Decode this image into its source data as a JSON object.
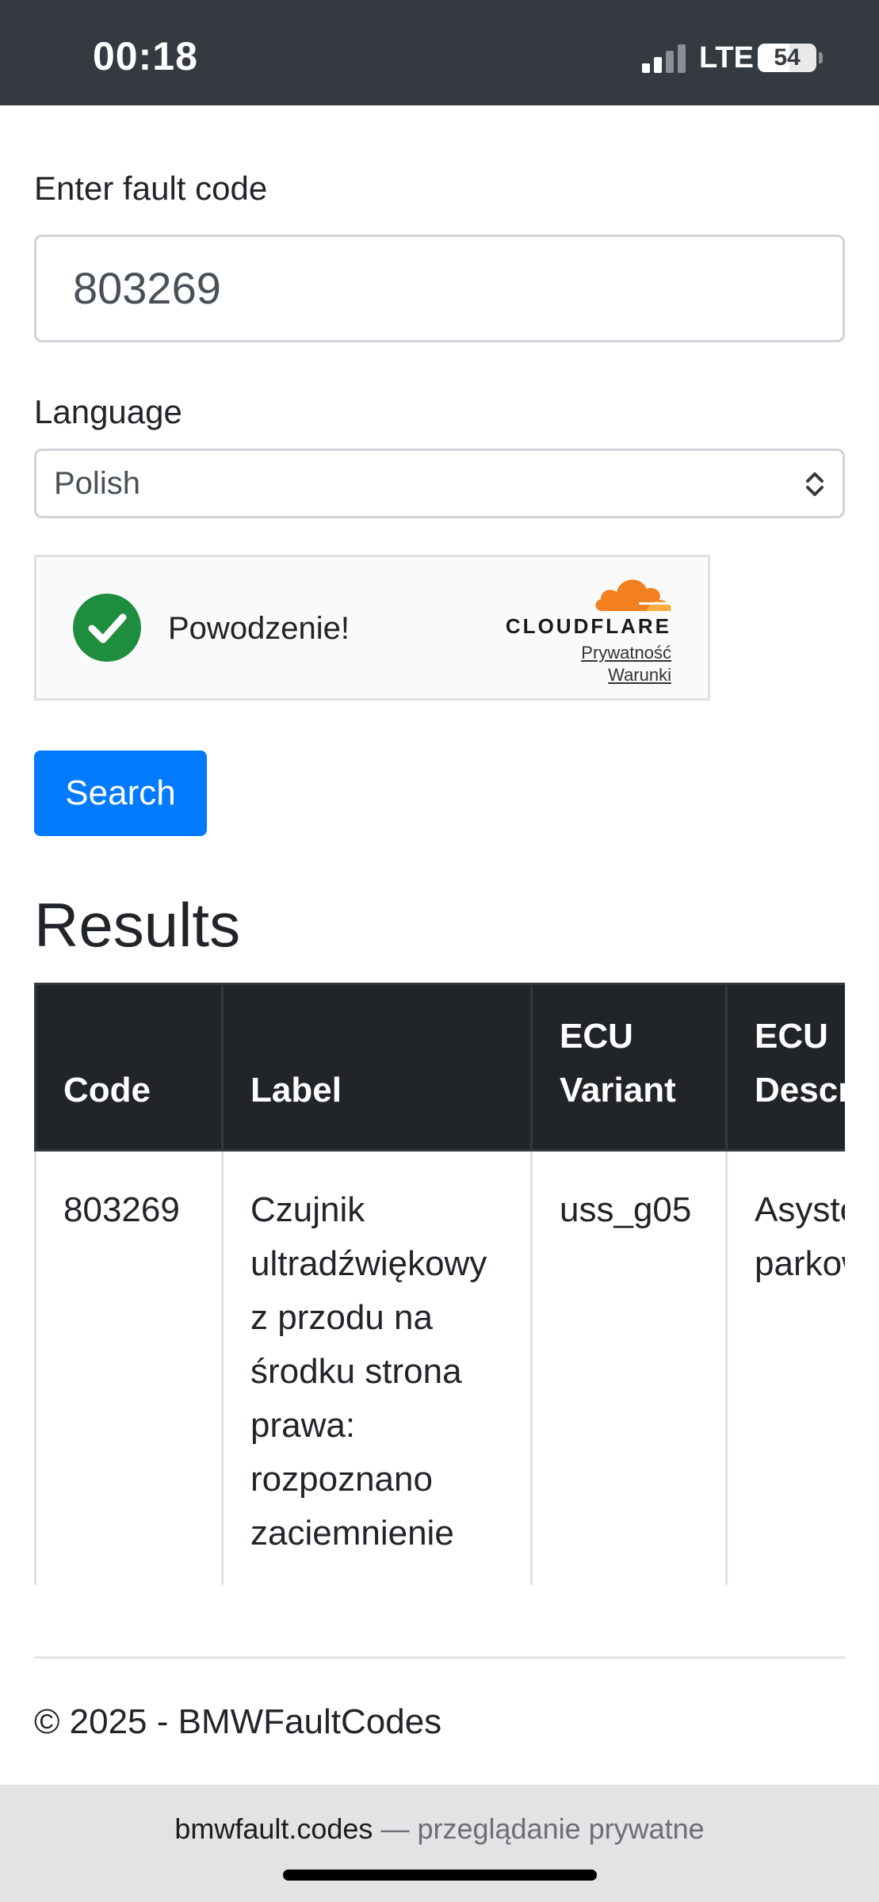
{
  "status_bar": {
    "time": "00:18",
    "network": "LTE",
    "battery": "54",
    "battery_level": 0.54
  },
  "form": {
    "fault_code_label": "Enter fault code",
    "fault_code_value": "803269",
    "language_label": "Language",
    "language_value": "Polish",
    "search_label": "Search"
  },
  "turnstile": {
    "message": "Powodzenie!",
    "brand": "CLOUDFLARE",
    "privacy_link": "Prywatność",
    "terms_link": "Warunki",
    "status_color": "#1e8e3e",
    "brand_color": "#f38020"
  },
  "results": {
    "title": "Results",
    "columns": [
      "Code",
      "Label",
      "ECU Variant",
      "ECU Description"
    ],
    "rows": [
      [
        "803269",
        "Czujnik ultradźwiękowy z przodu na środku strona prawa: rozpoznano zaciemnienie",
        "uss_g05",
        "Asystent parkowania"
      ]
    ]
  },
  "footer": {
    "copyright": "© 2025 - BMWFaultCodes"
  },
  "browser": {
    "domain": "bmwfault.codes",
    "separator": " — ",
    "mode": "przeglądanie prywatne"
  },
  "colors": {
    "primary": "#007bff",
    "table_header": "#212529",
    "status_bar": "#343a40"
  }
}
